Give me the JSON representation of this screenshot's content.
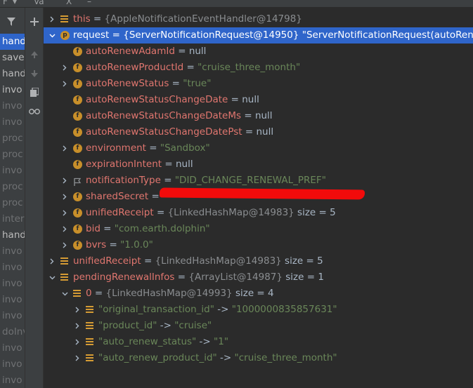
{
  "topbar": {
    "frames_label": "F",
    "vars_label": "Va",
    "close_label": "X",
    "extra": "–"
  },
  "frames": {
    "items": [
      {
        "label": "hand",
        "state": "selected"
      },
      {
        "label": "save",
        "state": "normal"
      },
      {
        "label": "hand",
        "state": "normal"
      },
      {
        "label": "invo",
        "state": "normal"
      },
      {
        "label": "invo",
        "state": "dim"
      },
      {
        "label": "invo",
        "state": "dim"
      },
      {
        "label": "proc",
        "state": "dim"
      },
      {
        "label": "proc",
        "state": "dim"
      },
      {
        "label": "invo",
        "state": "dim"
      },
      {
        "label": "proc",
        "state": "dim"
      },
      {
        "label": "proc",
        "state": "dim"
      },
      {
        "label": "inter",
        "state": "dim"
      },
      {
        "label": "hand",
        "state": "normal"
      },
      {
        "label": "invo",
        "state": "dim"
      },
      {
        "label": "invo",
        "state": "dim"
      },
      {
        "label": "invo",
        "state": "dim"
      },
      {
        "label": "invo",
        "state": "dim"
      },
      {
        "label": "invo",
        "state": "dim"
      },
      {
        "label": "doInv",
        "state": "dim"
      },
      {
        "label": "invo",
        "state": "dim"
      },
      {
        "label": "invo",
        "state": "dim"
      },
      {
        "label": "invo",
        "state": "dim"
      },
      {
        "label": "hanc",
        "state": "dim"
      }
    ]
  },
  "toolbar": {
    "add_icon": "plus-icon",
    "up_icon": "arrow-up-icon",
    "down_icon": "arrow-down-icon",
    "copy_icon": "copy-icon",
    "watch_icon": "glasses-icon"
  },
  "tree": {
    "rows": [
      {
        "indent": 0,
        "arrow": "collapsed",
        "icon": "list",
        "name": "this",
        "eq": " = ",
        "ref": "{AppleNotificationEventHandler@14798}",
        "str": "",
        "tail": ""
      },
      {
        "indent": 0,
        "arrow": "expanded",
        "icon": "p",
        "name": "request",
        "eq": " = ",
        "ref": "{ServerNotificationRequest@14950}",
        "str": " \"ServerNotificationRequest(autoRenew",
        "tail": "",
        "selected": true
      },
      {
        "indent": 1,
        "arrow": "none",
        "icon": "f",
        "name": "autoRenewAdamId",
        "eq": " = ",
        "ref": "",
        "str": "",
        "tail": "null"
      },
      {
        "indent": 1,
        "arrow": "collapsed",
        "icon": "f",
        "name": "autoRenewProductId",
        "eq": " = ",
        "ref": "",
        "str": "\"cruise_three_month\"",
        "tail": ""
      },
      {
        "indent": 1,
        "arrow": "collapsed",
        "icon": "f",
        "name": "autoRenewStatus",
        "eq": " = ",
        "ref": "",
        "str": "\"true\"",
        "tail": ""
      },
      {
        "indent": 1,
        "arrow": "none",
        "icon": "f",
        "name": "autoRenewStatusChangeDate",
        "eq": " = ",
        "ref": "",
        "str": "",
        "tail": "null"
      },
      {
        "indent": 1,
        "arrow": "none",
        "icon": "f",
        "name": "autoRenewStatusChangeDateMs",
        "eq": " = ",
        "ref": "",
        "str": "",
        "tail": "null"
      },
      {
        "indent": 1,
        "arrow": "none",
        "icon": "f",
        "name": "autoRenewStatusChangeDatePst",
        "eq": " = ",
        "ref": "",
        "str": "",
        "tail": "null"
      },
      {
        "indent": 1,
        "arrow": "collapsed",
        "icon": "f",
        "name": "environment",
        "eq": " = ",
        "ref": "",
        "str": "\"Sandbox\"",
        "tail": ""
      },
      {
        "indent": 1,
        "arrow": "none",
        "icon": "f",
        "name": "expirationIntent",
        "eq": " = ",
        "ref": "",
        "str": "",
        "tail": "null"
      },
      {
        "indent": 1,
        "arrow": "collapsed",
        "icon": "flag",
        "name": "notificationType",
        "eq": " = ",
        "ref": "",
        "str": "\"DID_CHANGE_RENEWAL_PREF\"",
        "tail": ""
      },
      {
        "indent": 1,
        "arrow": "collapsed",
        "icon": "f",
        "name": "sharedSecret",
        "eq": " = ",
        "ref": "",
        "str": "",
        "tail": ""
      },
      {
        "indent": 1,
        "arrow": "collapsed",
        "icon": "f",
        "name": "unifiedReceipt",
        "eq": " = ",
        "ref": "{LinkedHashMap@14983}",
        "str": "",
        "tail": "  size = 5"
      },
      {
        "indent": 1,
        "arrow": "collapsed",
        "icon": "f",
        "name": "bid",
        "eq": " = ",
        "ref": "",
        "str": "\"com.earth.dolphin\"",
        "tail": ""
      },
      {
        "indent": 1,
        "arrow": "collapsed",
        "icon": "f",
        "name": "bvrs",
        "eq": " = ",
        "ref": "",
        "str": "\"1.0.0\"",
        "tail": ""
      },
      {
        "indent": 0,
        "arrow": "collapsed",
        "icon": "list",
        "name": "unifiedReceipt",
        "eq": " = ",
        "ref": "{LinkedHashMap@14983}",
        "str": "",
        "tail": "  size = 5"
      },
      {
        "indent": 0,
        "arrow": "expanded",
        "icon": "list",
        "name": "pendingRenewalInfos",
        "eq": " = ",
        "ref": "{ArrayList@14987}",
        "str": "",
        "tail": "  size = 1"
      },
      {
        "indent": 1,
        "arrow": "expanded",
        "icon": "list",
        "name": "0",
        "eq": " = ",
        "ref": "{LinkedHashMap@14993}",
        "str": "",
        "tail": "  size = 4"
      },
      {
        "indent": 2,
        "arrow": "collapsed",
        "icon": "list",
        "name": "",
        "eq": "",
        "ref": "",
        "str": "\"original_transaction_id\"",
        "tail": " -> ",
        "str2": "\"1000000835857631\""
      },
      {
        "indent": 2,
        "arrow": "collapsed",
        "icon": "list",
        "name": "",
        "eq": "",
        "ref": "",
        "str": "\"product_id\"",
        "tail": " -> ",
        "str2": "\"cruise\""
      },
      {
        "indent": 2,
        "arrow": "collapsed",
        "icon": "list",
        "name": "",
        "eq": "",
        "ref": "",
        "str": "\"auto_renew_status\"",
        "tail": " -> ",
        "str2": "\"1\""
      },
      {
        "indent": 2,
        "arrow": "collapsed",
        "icon": "list",
        "name": "",
        "eq": "",
        "ref": "",
        "str": "\"auto_renew_product_id\"",
        "tail": " -> ",
        "str2": "\"cruise_three_month\""
      }
    ]
  },
  "colors": {
    "selection": "#2f65ca",
    "field_name": "#e0766f",
    "string_value": "#6a8759",
    "reference": "#8a8d90",
    "redaction": "#f20b0b"
  }
}
